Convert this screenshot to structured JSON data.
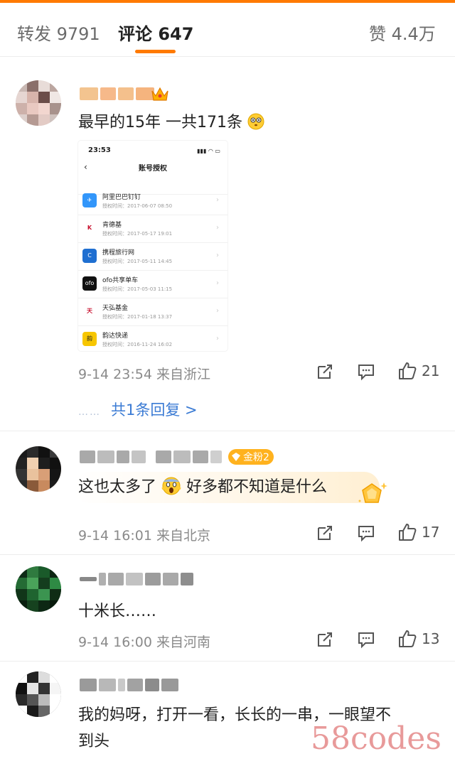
{
  "tabs": {
    "repost": "转发 9791",
    "comments": "评论 647",
    "likes": "赞 4.4万"
  },
  "colors": {
    "accent": "#ff7a00",
    "link": "#3b7bd4"
  },
  "comments": [
    {
      "text": "最早的15年  一共171条",
      "emoji": "flushed-face-icon",
      "meta": "9-14 23:54  来自浙江",
      "like_count": "21",
      "reply_link": "共1条回复 >",
      "reply_dots": "……",
      "screenshot": {
        "status_time": "23:53",
        "nav_title": "账号授权",
        "items": [
          {
            "name": "阿里巴巴钉钉",
            "time": "授权时间：2017-06-07 08:50"
          },
          {
            "name": "肯德基",
            "time": "授权时间：2017-05-17 19:01"
          },
          {
            "name": "携程旅行网",
            "time": "授权时间：2017-05-11 14:45"
          },
          {
            "name": "ofo共享单车",
            "time": "授权时间：2017-05-03 11:15"
          },
          {
            "name": "天弘基金",
            "time": "授权时间：2017-01-18 13:37"
          },
          {
            "name": "韵达快递",
            "time": "授权时间：2016-11-24 16:02"
          }
        ]
      }
    },
    {
      "text": "这也太多了",
      "text2": "好多都不知道是什么",
      "badge": "金粉2",
      "meta": "9-14 16:01  来自北京",
      "like_count": "17"
    },
    {
      "text": "十米长……",
      "meta": "9-14 16:00  来自河南",
      "like_count": "13"
    },
    {
      "text": "我的妈呀，打开一看，长长的一串，一眼望不",
      "text_line2": "到头"
    }
  ],
  "watermark": "58codes"
}
